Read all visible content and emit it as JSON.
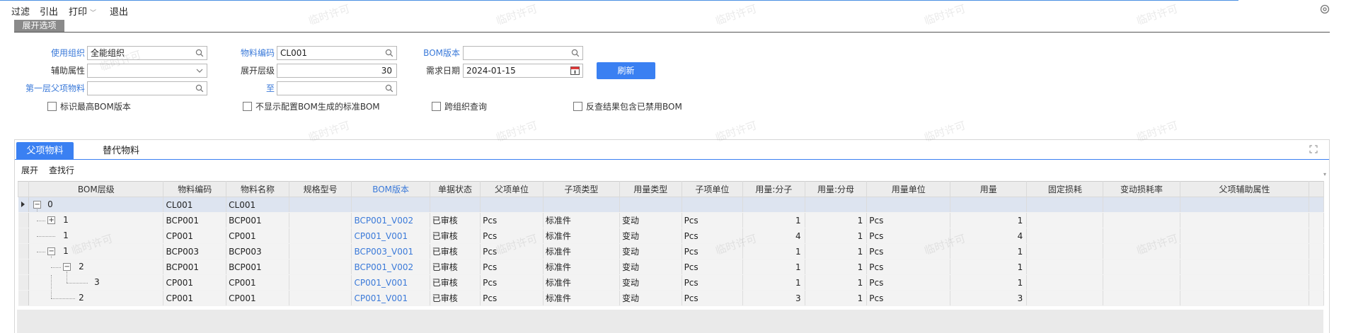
{
  "menu": {
    "filter": "过滤",
    "import": "引出",
    "print": "打印",
    "exit": "退出"
  },
  "section_tab": "展开选项",
  "form": {
    "org_label": "使用组织",
    "org_value": "全能组织",
    "aux_label": "辅助属性",
    "aux_value": "",
    "first_parent_label": "第一层父项物料",
    "first_parent_value": "",
    "material_label": "物料编码",
    "material_value": "CL001",
    "level_label": "展开层级",
    "level_value": "30",
    "to_label": "至",
    "to_value": "",
    "bom_label": "BOM版本",
    "bom_value": "",
    "date_label": "需求日期",
    "date_value": "2024-01-15",
    "refresh_label": "刷新"
  },
  "checkboxes": [
    {
      "label": "标识最高BOM版本",
      "checked": false
    },
    {
      "label": "不显示配置BOM生成的标准BOM",
      "checked": false
    },
    {
      "label": "跨组织查询",
      "checked": false
    },
    {
      "label": "反查结果包含已禁用BOM",
      "checked": false
    }
  ],
  "panel_tabs": {
    "active": "父项物料",
    "inactive": "替代物料"
  },
  "subbar": {
    "expand": "展开",
    "find": "查找行"
  },
  "table": {
    "columns": [
      "BOM层级",
      "物料编码",
      "物料名称",
      "规格型号",
      "BOM版本",
      "单据状态",
      "父项单位",
      "子项类型",
      "用量类型",
      "子项单位",
      "用量:分子",
      "用量:分母",
      "用量单位",
      "用量",
      "固定损耗",
      "变动损耗率",
      "父项辅助属性"
    ],
    "rows": [
      {
        "level": "0",
        "code": "CL001",
        "name": "CL001",
        "spec": "",
        "bom": "",
        "status": "",
        "punit": "",
        "ctype": "",
        "qtype": "",
        "cunit": "",
        "num": "",
        "den": "",
        "qunit": "",
        "qty": "",
        "fixed": "",
        "var": "",
        "aux": ""
      },
      {
        "level": "1",
        "code": "BCP001",
        "name": "BCP001",
        "spec": "",
        "bom": "BCP001_V002",
        "status": "已审核",
        "punit": "Pcs",
        "ctype": "标准件",
        "qtype": "变动",
        "cunit": "Pcs",
        "num": "1",
        "den": "1",
        "qunit": "Pcs",
        "qty": "1",
        "fixed": "",
        "var": "",
        "aux": ""
      },
      {
        "level": "1",
        "code": "CP001",
        "name": "CP001",
        "spec": "",
        "bom": "CP001_V001",
        "status": "已审核",
        "punit": "Pcs",
        "ctype": "标准件",
        "qtype": "变动",
        "cunit": "Pcs",
        "num": "4",
        "den": "1",
        "qunit": "Pcs",
        "qty": "4",
        "fixed": "",
        "var": "",
        "aux": ""
      },
      {
        "level": "1",
        "code": "BCP003",
        "name": "BCP003",
        "spec": "",
        "bom": "BCP003_V001",
        "status": "已审核",
        "punit": "Pcs",
        "ctype": "标准件",
        "qtype": "变动",
        "cunit": "Pcs",
        "num": "1",
        "den": "1",
        "qunit": "Pcs",
        "qty": "1",
        "fixed": "",
        "var": "",
        "aux": ""
      },
      {
        "level": "2",
        "code": "BCP001",
        "name": "BCP001",
        "spec": "",
        "bom": "BCP001_V002",
        "status": "已审核",
        "punit": "Pcs",
        "ctype": "标准件",
        "qtype": "变动",
        "cunit": "Pcs",
        "num": "1",
        "den": "1",
        "qunit": "Pcs",
        "qty": "1",
        "fixed": "",
        "var": "",
        "aux": ""
      },
      {
        "level": "3",
        "code": "CP001",
        "name": "CP001",
        "spec": "",
        "bom": "CP001_V001",
        "status": "已审核",
        "punit": "Pcs",
        "ctype": "标准件",
        "qtype": "变动",
        "cunit": "Pcs",
        "num": "1",
        "den": "1",
        "qunit": "Pcs",
        "qty": "1",
        "fixed": "",
        "var": "",
        "aux": ""
      },
      {
        "level": "2",
        "code": "CP001",
        "name": "CP001",
        "spec": "",
        "bom": "CP001_V001",
        "status": "已审核",
        "punit": "Pcs",
        "ctype": "标准件",
        "qtype": "变动",
        "cunit": "Pcs",
        "num": "3",
        "den": "1",
        "qunit": "Pcs",
        "qty": "3",
        "fixed": "",
        "var": "",
        "aux": ""
      }
    ]
  },
  "watermark": "临时许可",
  "colors": {
    "accent": "#3a80f2",
    "link": "#3b7ad9"
  }
}
